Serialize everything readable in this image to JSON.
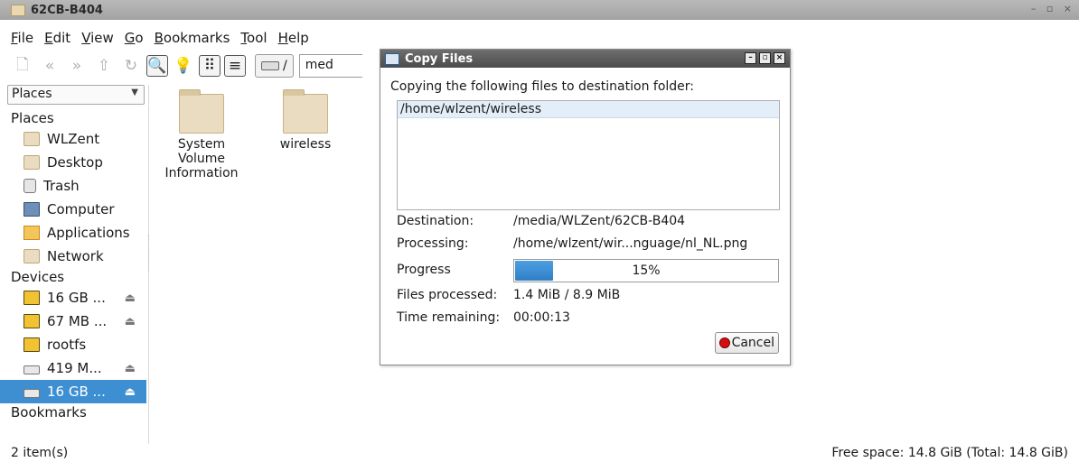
{
  "window": {
    "title": "62CB-B404",
    "controls": "– ▫ ×"
  },
  "menubar": [
    {
      "u": "F",
      "rest": "ile"
    },
    {
      "u": "E",
      "rest": "dit"
    },
    {
      "u": "V",
      "rest": "iew"
    },
    {
      "u": "G",
      "rest": "o"
    },
    {
      "u": "B",
      "rest": "ookmarks"
    },
    {
      "u": "T",
      "rest": "ool"
    },
    {
      "u": "H",
      "rest": "elp"
    }
  ],
  "toolbar": {
    "path_button": "/",
    "path_entry": "med"
  },
  "sidebar": {
    "combo_value": "Places",
    "places_heading": "Places",
    "places": [
      {
        "label": "WLZent",
        "icon": "home-folder-icon"
      },
      {
        "label": "Desktop",
        "icon": "desktop-folder-icon"
      },
      {
        "label": "Trash",
        "icon": "trash-icon"
      },
      {
        "label": "Computer",
        "icon": "computer-icon"
      },
      {
        "label": "Applications",
        "icon": "applications-icon"
      },
      {
        "label": "Network",
        "icon": "network-folder-icon"
      }
    ],
    "devices_heading": "Devices",
    "devices": [
      {
        "label": "16 GB ...",
        "icon": "usb-drive-icon",
        "eject": true
      },
      {
        "label": "67 MB ...",
        "icon": "usb-drive-icon",
        "eject": true
      },
      {
        "label": "rootfs",
        "icon": "usb-drive-icon",
        "eject": false
      },
      {
        "label": "419 M...",
        "icon": "disk-icon",
        "eject": true
      },
      {
        "label": "16 GB ...",
        "icon": "disk-icon",
        "eject": true,
        "selected": true
      }
    ],
    "bookmarks_heading": "Bookmarks"
  },
  "files": [
    {
      "name": "System Volume Information"
    },
    {
      "name": "wireless"
    }
  ],
  "statusbar": {
    "items": "2 item(s)",
    "free_space": "Free space: 14.8 GiB (Total: 14.8 GiB)"
  },
  "dialog": {
    "title": "Copy Files",
    "message": "Copying the following files to destination folder:",
    "files": [
      "/home/wlzent/wireless"
    ],
    "destination_label": "Destination:",
    "destination_value": "/media/WLZent/62CB-B404",
    "processing_label": "Processing:",
    "processing_value": "/home/wlzent/wir...nguage/nl_NL.png",
    "progress_label": "Progress",
    "progress_percent": 15,
    "progress_text": "15%",
    "files_processed_label": "Files processed:",
    "files_processed_value": "1.4 MiB / 8.9 MiB",
    "time_remaining_label": "Time remaining:",
    "time_remaining_value": "00:00:13",
    "cancel_label": "Cancel"
  },
  "colors": {
    "selection": "#3d8fd1",
    "progress": "#2f7fc6",
    "cancel_dot": "#d31010"
  }
}
